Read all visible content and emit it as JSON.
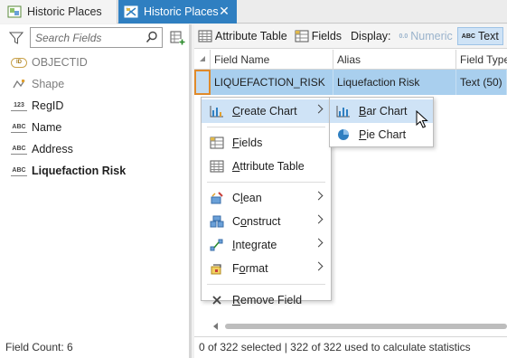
{
  "tabs": [
    {
      "label": "Historic Places",
      "active": false
    },
    {
      "label": "Historic Places",
      "active": true,
      "close_icon": "close-icon"
    }
  ],
  "search": {
    "placeholder": "Search Fields"
  },
  "fields": [
    {
      "name": "OBJECTID",
      "type_icon": "objectid-icon",
      "dim": true,
      "bold": false
    },
    {
      "name": "Shape",
      "type_icon": "shape-icon",
      "dim": true,
      "bold": false
    },
    {
      "name": "RegID",
      "type_icon": "numeric-field-icon",
      "dim": false,
      "bold": false
    },
    {
      "name": "Name",
      "type_icon": "text-field-icon",
      "dim": false,
      "bold": false
    },
    {
      "name": "Address",
      "type_icon": "text-field-icon",
      "dim": false,
      "bold": false
    },
    {
      "name": "Liquefaction Risk",
      "type_icon": "text-field-icon",
      "dim": false,
      "bold": true
    }
  ],
  "field_count": "Field Count: 6",
  "toolbar": {
    "attribute_table": "Attribute Table",
    "fields": "Fields",
    "display_label": "Display:",
    "numeric": "Numeric",
    "text": "Text"
  },
  "grid": {
    "headers": [
      "Field Name",
      "Alias",
      "Field Type"
    ],
    "rows": [
      {
        "field_name": "LIQUEFACTION_RISK",
        "alias": "Liquefaction Risk",
        "field_type": "Text (50)"
      }
    ]
  },
  "status": "0 of 322 selected | 322 of 322 used to calculate statistics",
  "context_menu": {
    "create_chart": {
      "pre": "",
      "key": "C",
      "post": "reate Chart"
    },
    "fields": {
      "pre": "",
      "key": "F",
      "post": "ields"
    },
    "attribute_table": {
      "pre": "",
      "key": "A",
      "post": "ttribute Table"
    },
    "clean": {
      "pre": "C",
      "key": "l",
      "post": "ean"
    },
    "construct": {
      "pre": "C",
      "key": "o",
      "post": "nstruct"
    },
    "integrate": {
      "pre": "",
      "key": "I",
      "post": "ntegrate"
    },
    "format": {
      "pre": "F",
      "key": "o",
      "post": "rmat"
    },
    "remove_field": {
      "pre": "",
      "key": "R",
      "post": "emove Field"
    }
  },
  "submenu": {
    "bar_chart": {
      "pre": "",
      "key": "B",
      "post": "ar Chart"
    },
    "pie_chart": {
      "pre": "",
      "key": "P",
      "post": "ie Chart"
    }
  },
  "colors": {
    "active_tab": "#2f7fc1",
    "selected_row": "#a9cfee",
    "menu_highlight": "#cfe3f6",
    "row_selector_border": "#e08a2a"
  }
}
